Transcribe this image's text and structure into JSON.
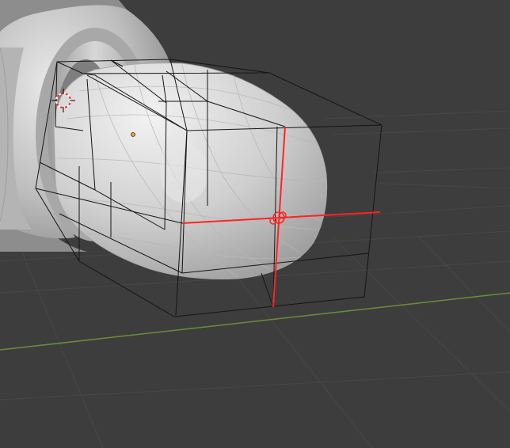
{
  "viewport": {
    "background": "#3d3d3d",
    "grid_color": "#484848",
    "x_axis_color": "#6e8c3a",
    "mesh_color": "#c8c8c8",
    "cage_color": "#1a1a1a",
    "cursor_color": "#ff2a2a",
    "origin_color": "#f0a030",
    "icons": {
      "camera": "3d-cursor-icon",
      "lattice_handle": "lattice-origin-icon"
    }
  }
}
